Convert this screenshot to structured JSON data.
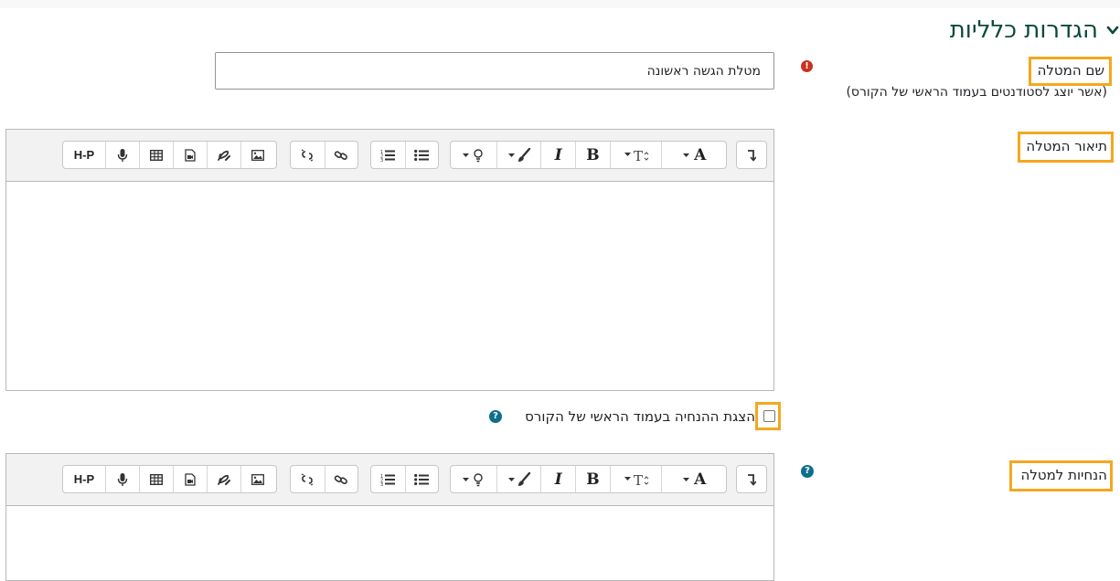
{
  "section": {
    "title": "הגדרות כלליות"
  },
  "fields": {
    "task_name": {
      "label": "שם המטלה",
      "sublabel": "(אשר יוצג לסטודנטים בעמוד הראשי של הקורס)",
      "value": "מטלת הגשה ראשונה",
      "required_icon": "exclamation-icon"
    },
    "description": {
      "label": "תיאור המטלה"
    },
    "show_instructions": {
      "label": "הצגת ההנחיה בעמוד הראשי של הקורס",
      "checked": false,
      "help_icon": "question-icon"
    },
    "instructions": {
      "label": "הנחיות למטלה",
      "help_icon": "question-icon"
    }
  },
  "toolbar": {
    "groups": [
      [
        "toolbar-toggle"
      ],
      [
        "font-color",
        "font-size",
        "bold",
        "italic",
        "background-color",
        "highlight"
      ],
      [
        "bullet-list",
        "numbered-list"
      ],
      [
        "link",
        "unlink"
      ],
      [
        "image",
        "drawing",
        "media",
        "table",
        "record-audio",
        "h5p"
      ]
    ],
    "h5p_label": "H-P",
    "bold_label": "B",
    "italic_label": "I",
    "font_color_label": "A"
  },
  "colors": {
    "accent_title": "#0d4a3c",
    "highlight_box": "#f5a71f",
    "required": "#ca3120",
    "help": "#0f6e8c"
  }
}
